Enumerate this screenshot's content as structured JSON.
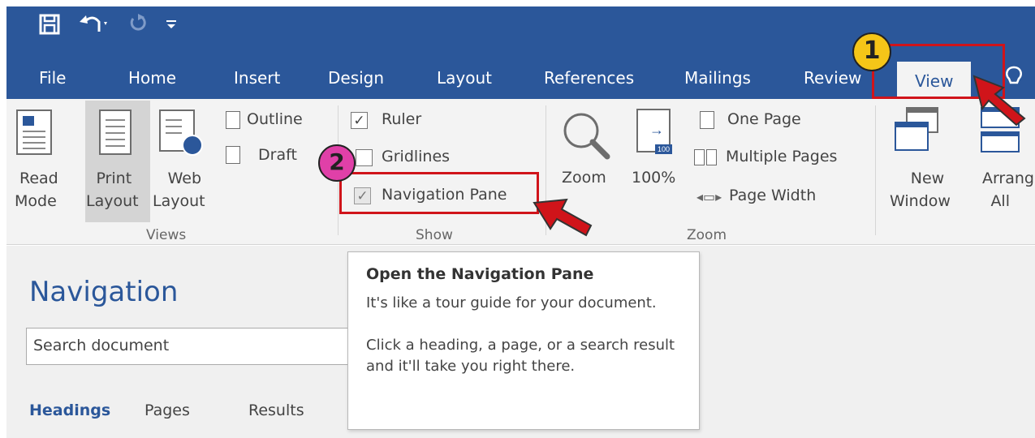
{
  "qat": {
    "icons": [
      "save-icon",
      "undo-icon",
      "redo-icon",
      "customize-icon"
    ]
  },
  "tabs": [
    "File",
    "Home",
    "Insert",
    "Design",
    "Layout",
    "References",
    "Mailings",
    "Review",
    "View"
  ],
  "active_tab": "View",
  "tell_me_icon": "lightbulb-icon",
  "ribbon": {
    "views": {
      "group_label": "Views",
      "read_mode": [
        "Read",
        "Mode"
      ],
      "print_layout": [
        "Print",
        "Layout"
      ],
      "web_layout": [
        "Web",
        "Layout"
      ],
      "outline": "Outline",
      "draft": "Draft"
    },
    "show": {
      "group_label": "Show",
      "ruler": "Ruler",
      "gridlines": "Gridlines",
      "navigation_pane": "Navigation Pane",
      "ruler_checked": true,
      "gridlines_checked": false,
      "navigation_checked": true
    },
    "zoom": {
      "group_label": "Zoom",
      "zoom": "Zoom",
      "hundred": "100%",
      "one_page": "One Page",
      "multiple_pages": "Multiple Pages",
      "page_width": "Page Width",
      "badge_100": "100"
    },
    "window": {
      "new_window": [
        "New",
        "Window"
      ],
      "arrange_all": [
        "Arrang",
        "All"
      ]
    }
  },
  "annotations": {
    "step1": "1",
    "step2": "2",
    "accent": "#d0141a",
    "badge1_color": "#f5c518",
    "badge2_color": "#e040a8"
  },
  "nav_pane": {
    "title": "Navigation",
    "search_placeholder": "Search document",
    "tabs": [
      "Headings",
      "Pages",
      "Results"
    ]
  },
  "tooltip": {
    "title": "Open the Navigation Pane",
    "body1": "It's like a tour guide for your document.",
    "body2": "Click a heading, a page, or a search result and it'll take you right there."
  },
  "colors": {
    "word_blue": "#2b579a",
    "ribbon_bg": "#f3f3f3"
  }
}
